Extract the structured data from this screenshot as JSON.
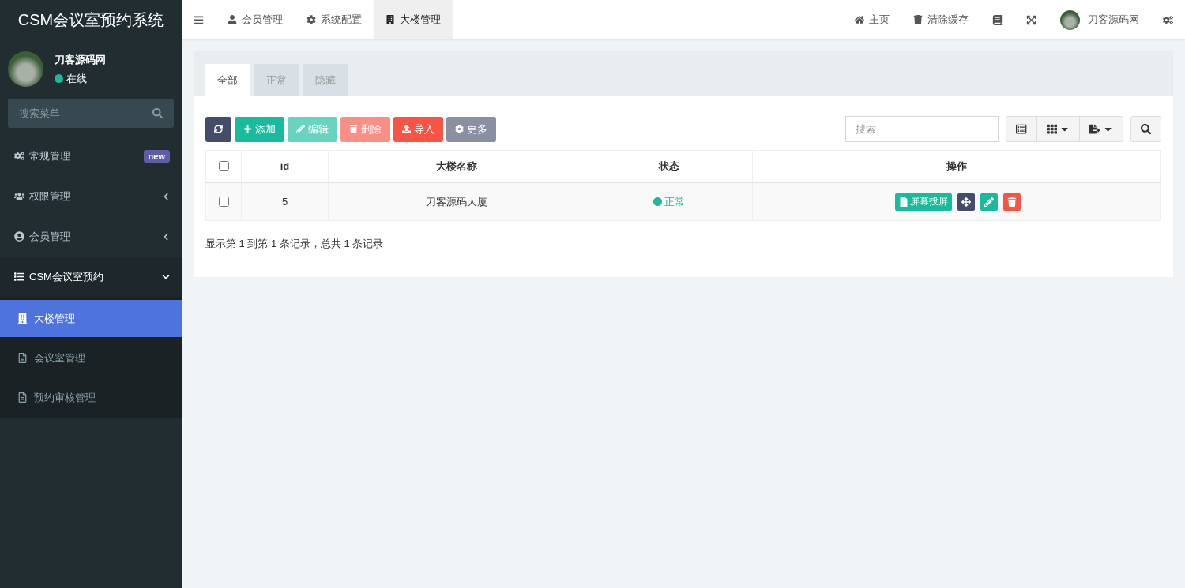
{
  "app_title": "CSM会议室预约系统",
  "user": {
    "name": "刀客源码网",
    "status": "在线"
  },
  "sidebar_search": {
    "placeholder": "搜索菜单"
  },
  "sidebar": {
    "items": [
      {
        "kind": "link",
        "label": "常规管理",
        "badge": "new"
      },
      {
        "kind": "group",
        "label": "权限管理",
        "expanded": false
      },
      {
        "kind": "group",
        "label": "会员管理",
        "expanded": false
      },
      {
        "kind": "group",
        "label": "CSM会议室预约",
        "expanded": true,
        "children": [
          {
            "label": "大楼管理",
            "selected": true
          },
          {
            "label": "会议室管理",
            "selected": false
          },
          {
            "label": "预约审核管理",
            "selected": false
          }
        ]
      }
    ]
  },
  "top_tabs": [
    {
      "label": "会员管理",
      "selected": false
    },
    {
      "label": "系统配置",
      "selected": false
    },
    {
      "label": "大楼管理",
      "selected": true
    }
  ],
  "top_links": [
    "主页",
    "清除缓存"
  ],
  "top_user": "刀客源码网",
  "filter_tabs": [
    {
      "label": "全部",
      "selected": true
    },
    {
      "label": "正常",
      "selected": false
    },
    {
      "label": "隐藏",
      "selected": false
    }
  ],
  "toolbar": [
    {
      "kind": "refresh",
      "disabled": false
    },
    {
      "kind": "add",
      "label": "添加",
      "disabled": false
    },
    {
      "kind": "edit",
      "label": "编辑",
      "disabled": true
    },
    {
      "kind": "delete",
      "label": "删除",
      "disabled": true
    },
    {
      "kind": "import",
      "label": "导入",
      "disabled": false
    },
    {
      "kind": "more",
      "label": "更多",
      "disabled": false
    }
  ],
  "table_search": {
    "placeholder": "搜索"
  },
  "table": {
    "select_all": false,
    "columns": [
      "id",
      "大楼名称",
      "状态",
      "操作"
    ],
    "rows": [
      {
        "checked": false,
        "id": "5",
        "name": "刀客源码大厦",
        "status": "正常",
        "color": "#18bc9c",
        "action": "屏幕投屏"
      }
    ]
  },
  "pagination_info": "显示第 1 到第 1 条记录，总共 1 条记录"
}
